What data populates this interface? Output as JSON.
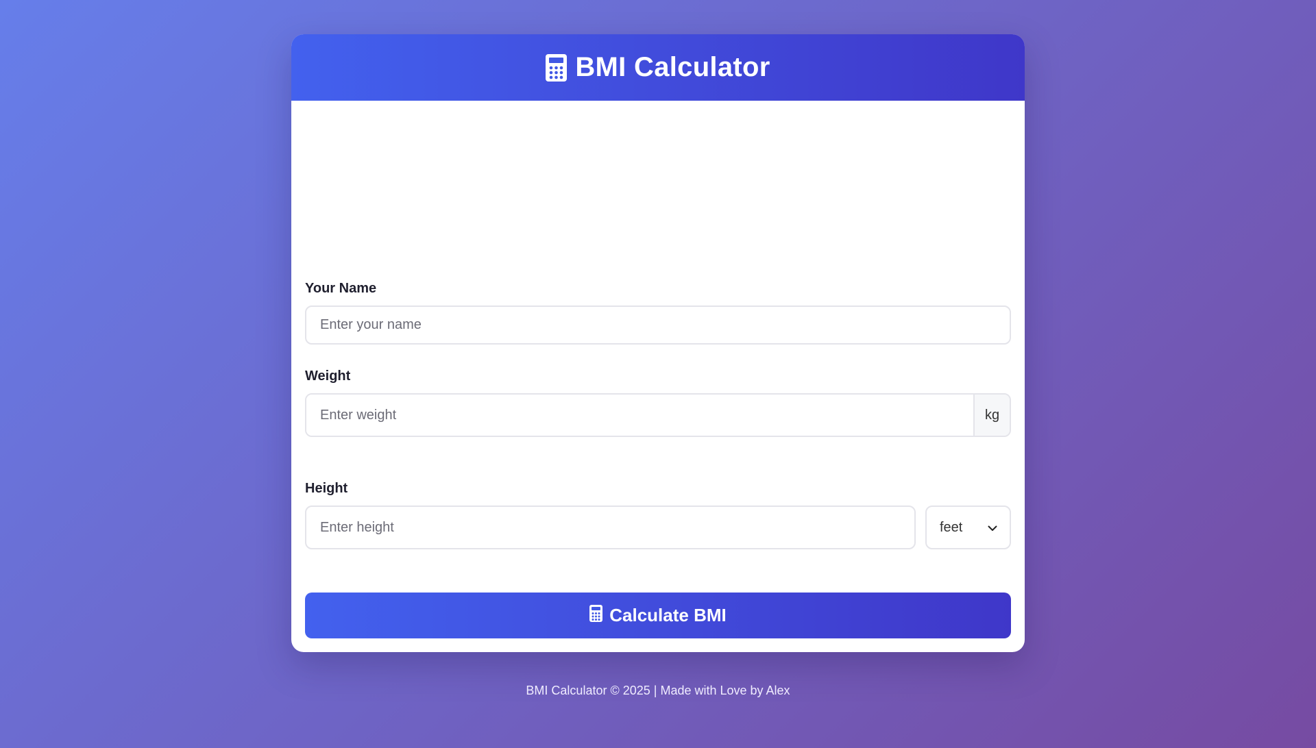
{
  "header": {
    "title": "BMI Calculator",
    "icon": "calculator-icon"
  },
  "form": {
    "name": {
      "label": "Your Name",
      "value": "",
      "placeholder": "Enter your name"
    },
    "weight": {
      "label": "Weight",
      "value": "",
      "placeholder": "Enter weight",
      "unit": "kg"
    },
    "height": {
      "label": "Height",
      "value": "",
      "placeholder": "Enter height",
      "unit_selected": "feet"
    },
    "submit_label": "Calculate BMI",
    "submit_icon": "calculator-icon"
  },
  "footer": {
    "text": "BMI Calculator © 2025 | Made with Love by Alex"
  },
  "colors": {
    "background_start": "#667eea",
    "background_end": "#764ba2",
    "accent_start": "#4361ee",
    "accent_end": "#3f37c9"
  }
}
